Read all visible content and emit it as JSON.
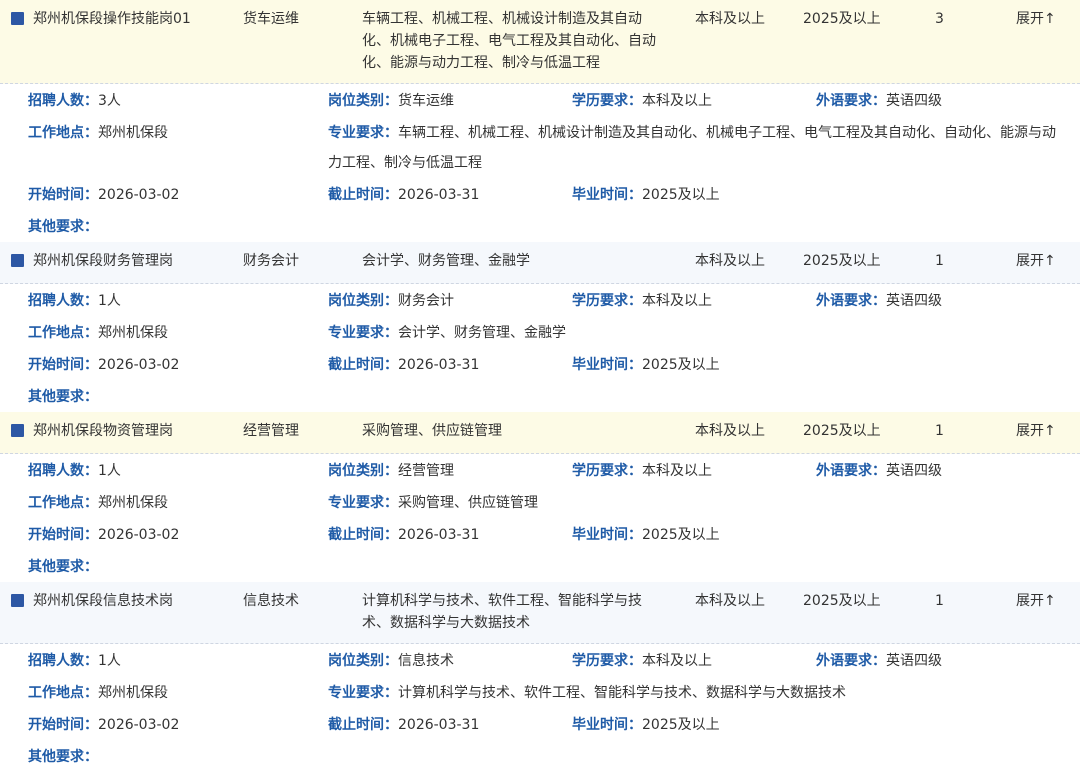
{
  "labels": {
    "count": "招聘人数：",
    "category": "岗位类别：",
    "education": "学历要求：",
    "language": "外语要求：",
    "location": "工作地点：",
    "major": "专业要求：",
    "start": "开始时间：",
    "end": "截止时间：",
    "graduation": "毕业时间：",
    "other": "其他要求：",
    "expand": "展开↑"
  },
  "jobs": [
    {
      "name": "郑州机保段操作技能岗01",
      "category": "货车运维",
      "major": "车辆工程、机械工程、机械设计制造及其自动化、机械电子工程、电气工程及其自动化、自动化、能源与动力工程、制冷与低温工程",
      "education": "本科及以上",
      "grad_year": "2025及以上",
      "count": "3",
      "count_people": "3人",
      "language": "英语四级",
      "location": "郑州机保段",
      "start": "2026-03-02",
      "end": "2026-03-31",
      "other": ""
    },
    {
      "name": "郑州机保段财务管理岗",
      "category": "财务会计",
      "major": "会计学、财务管理、金融学",
      "education": "本科及以上",
      "grad_year": "2025及以上",
      "count": "1",
      "count_people": "1人",
      "language": "英语四级",
      "location": "郑州机保段",
      "start": "2026-03-02",
      "end": "2026-03-31",
      "other": ""
    },
    {
      "name": "郑州机保段物资管理岗",
      "category": "经营管理",
      "major": "采购管理、供应链管理",
      "education": "本科及以上",
      "grad_year": "2025及以上",
      "count": "1",
      "count_people": "1人",
      "language": "英语四级",
      "location": "郑州机保段",
      "start": "2026-03-02",
      "end": "2026-03-31",
      "other": ""
    },
    {
      "name": "郑州机保段信息技术岗",
      "category": "信息技术",
      "major": "计算机科学与技术、软件工程、智能科学与技术、数据科学与大数据技术",
      "education": "本科及以上",
      "grad_year": "2025及以上",
      "count": "1",
      "count_people": "1人",
      "language": "英语四级",
      "location": "郑州机保段",
      "start": "2026-03-02",
      "end": "2026-03-31",
      "other": ""
    }
  ]
}
